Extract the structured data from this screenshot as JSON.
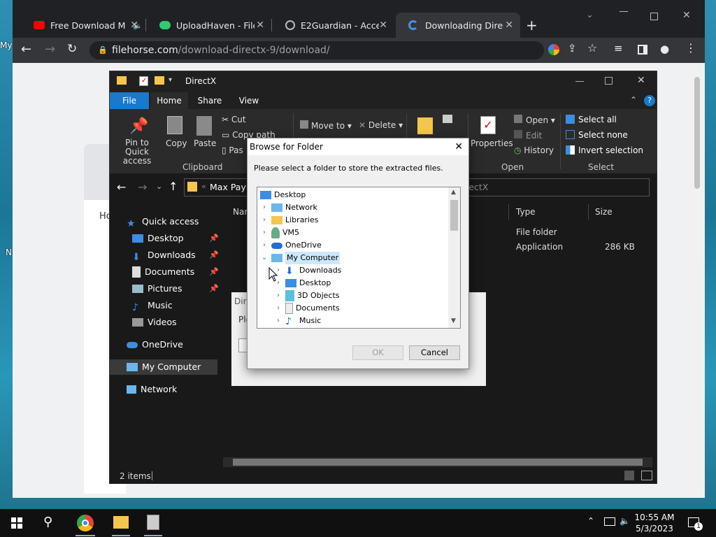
{
  "desktop": {
    "icon_labels": [
      "My",
      "N"
    ]
  },
  "browser": {
    "tabs": [
      {
        "title": "Free Download M",
        "icon": "youtube-icon"
      },
      {
        "title": "UploadHaven - File S",
        "icon": "uploadhaven-icon"
      },
      {
        "title": "E2Guardian - Access",
        "icon": "globe-icon"
      },
      {
        "title": "Downloading Direct",
        "icon": "filehorse-icon"
      }
    ],
    "url_domain": "filehorse.com",
    "url_path": "/download-directx-9/download/",
    "page_text": "Ho"
  },
  "explorer": {
    "title": "DirectX",
    "ribbon_tabs": [
      "File",
      "Home",
      "Share",
      "View"
    ],
    "clipboard": {
      "pin": "Pin to Quick access",
      "copy": "Copy",
      "paste": "Paste",
      "cut": "Cut",
      "copy_path": "Copy path",
      "paste_short": "Pas",
      "label": "Clipboard"
    },
    "organize": {
      "move_to": "Move to",
      "delete": "Delete"
    },
    "open": {
      "properties": "Properties",
      "open": "Open",
      "edit": "Edit",
      "history": "History",
      "label": "Open"
    },
    "select": {
      "all": "Select all",
      "none": "Select none",
      "invert": "Invert selection",
      "label": "Select"
    },
    "address": {
      "crumb": "Max Payn",
      "right": "irectX"
    },
    "nav": {
      "quick_access": "Quick access",
      "items": [
        "Desktop",
        "Downloads",
        "Documents",
        "Pictures",
        "Music",
        "Videos"
      ],
      "onedrive": "OneDrive",
      "my_computer": "My Computer",
      "network": "Network"
    },
    "columns": {
      "name": "Nar",
      "type": "Type",
      "size": "Size"
    },
    "rows": [
      {
        "type": "File folder",
        "size": ""
      },
      {
        "type": "Application",
        "size": "286 KB"
      }
    ],
    "behind_dialog": {
      "title": "Dire",
      "text": "Ple"
    },
    "status": "2 items"
  },
  "dialog": {
    "title": "Browse for Folder",
    "message": "Please select a folder to store the extracted files.",
    "tree": [
      "Desktop",
      "Network",
      "Libraries",
      "VM5",
      "OneDrive",
      "My Computer",
      "Downloads",
      "Desktop",
      "3D Objects",
      "Documents",
      "Music"
    ],
    "ok": "OK",
    "cancel": "Cancel"
  },
  "taskbar": {
    "time": "10:55 AM",
    "date": "5/3/2023",
    "notification_count": "1"
  }
}
